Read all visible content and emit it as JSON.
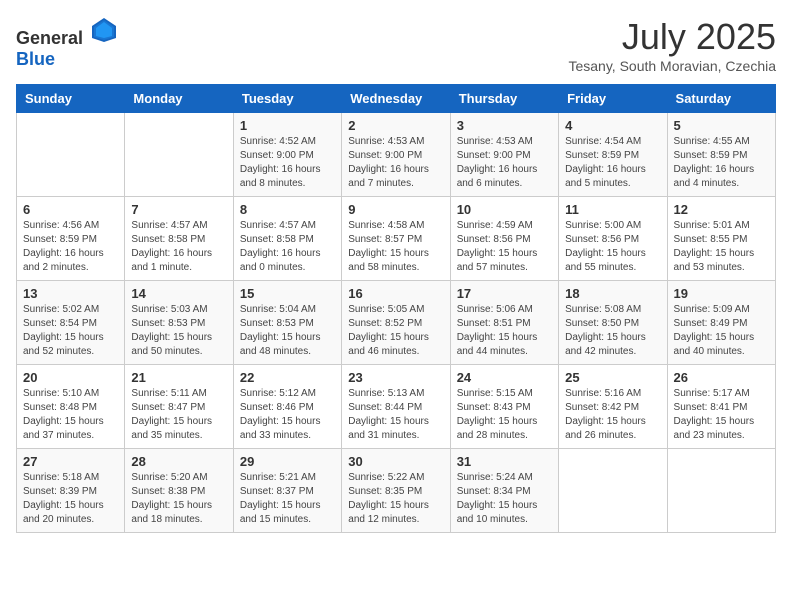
{
  "header": {
    "logo_general": "General",
    "logo_blue": "Blue",
    "month": "July 2025",
    "location": "Tesany, South Moravian, Czechia"
  },
  "days_of_week": [
    "Sunday",
    "Monday",
    "Tuesday",
    "Wednesday",
    "Thursday",
    "Friday",
    "Saturday"
  ],
  "weeks": [
    [
      {
        "day": "",
        "info": ""
      },
      {
        "day": "",
        "info": ""
      },
      {
        "day": "1",
        "info": "Sunrise: 4:52 AM\nSunset: 9:00 PM\nDaylight: 16 hours and 8 minutes."
      },
      {
        "day": "2",
        "info": "Sunrise: 4:53 AM\nSunset: 9:00 PM\nDaylight: 16 hours and 7 minutes."
      },
      {
        "day": "3",
        "info": "Sunrise: 4:53 AM\nSunset: 9:00 PM\nDaylight: 16 hours and 6 minutes."
      },
      {
        "day": "4",
        "info": "Sunrise: 4:54 AM\nSunset: 8:59 PM\nDaylight: 16 hours and 5 minutes."
      },
      {
        "day": "5",
        "info": "Sunrise: 4:55 AM\nSunset: 8:59 PM\nDaylight: 16 hours and 4 minutes."
      }
    ],
    [
      {
        "day": "6",
        "info": "Sunrise: 4:56 AM\nSunset: 8:59 PM\nDaylight: 16 hours and 2 minutes."
      },
      {
        "day": "7",
        "info": "Sunrise: 4:57 AM\nSunset: 8:58 PM\nDaylight: 16 hours and 1 minute."
      },
      {
        "day": "8",
        "info": "Sunrise: 4:57 AM\nSunset: 8:58 PM\nDaylight: 16 hours and 0 minutes."
      },
      {
        "day": "9",
        "info": "Sunrise: 4:58 AM\nSunset: 8:57 PM\nDaylight: 15 hours and 58 minutes."
      },
      {
        "day": "10",
        "info": "Sunrise: 4:59 AM\nSunset: 8:56 PM\nDaylight: 15 hours and 57 minutes."
      },
      {
        "day": "11",
        "info": "Sunrise: 5:00 AM\nSunset: 8:56 PM\nDaylight: 15 hours and 55 minutes."
      },
      {
        "day": "12",
        "info": "Sunrise: 5:01 AM\nSunset: 8:55 PM\nDaylight: 15 hours and 53 minutes."
      }
    ],
    [
      {
        "day": "13",
        "info": "Sunrise: 5:02 AM\nSunset: 8:54 PM\nDaylight: 15 hours and 52 minutes."
      },
      {
        "day": "14",
        "info": "Sunrise: 5:03 AM\nSunset: 8:53 PM\nDaylight: 15 hours and 50 minutes."
      },
      {
        "day": "15",
        "info": "Sunrise: 5:04 AM\nSunset: 8:53 PM\nDaylight: 15 hours and 48 minutes."
      },
      {
        "day": "16",
        "info": "Sunrise: 5:05 AM\nSunset: 8:52 PM\nDaylight: 15 hours and 46 minutes."
      },
      {
        "day": "17",
        "info": "Sunrise: 5:06 AM\nSunset: 8:51 PM\nDaylight: 15 hours and 44 minutes."
      },
      {
        "day": "18",
        "info": "Sunrise: 5:08 AM\nSunset: 8:50 PM\nDaylight: 15 hours and 42 minutes."
      },
      {
        "day": "19",
        "info": "Sunrise: 5:09 AM\nSunset: 8:49 PM\nDaylight: 15 hours and 40 minutes."
      }
    ],
    [
      {
        "day": "20",
        "info": "Sunrise: 5:10 AM\nSunset: 8:48 PM\nDaylight: 15 hours and 37 minutes."
      },
      {
        "day": "21",
        "info": "Sunrise: 5:11 AM\nSunset: 8:47 PM\nDaylight: 15 hours and 35 minutes."
      },
      {
        "day": "22",
        "info": "Sunrise: 5:12 AM\nSunset: 8:46 PM\nDaylight: 15 hours and 33 minutes."
      },
      {
        "day": "23",
        "info": "Sunrise: 5:13 AM\nSunset: 8:44 PM\nDaylight: 15 hours and 31 minutes."
      },
      {
        "day": "24",
        "info": "Sunrise: 5:15 AM\nSunset: 8:43 PM\nDaylight: 15 hours and 28 minutes."
      },
      {
        "day": "25",
        "info": "Sunrise: 5:16 AM\nSunset: 8:42 PM\nDaylight: 15 hours and 26 minutes."
      },
      {
        "day": "26",
        "info": "Sunrise: 5:17 AM\nSunset: 8:41 PM\nDaylight: 15 hours and 23 minutes."
      }
    ],
    [
      {
        "day": "27",
        "info": "Sunrise: 5:18 AM\nSunset: 8:39 PM\nDaylight: 15 hours and 20 minutes."
      },
      {
        "day": "28",
        "info": "Sunrise: 5:20 AM\nSunset: 8:38 PM\nDaylight: 15 hours and 18 minutes."
      },
      {
        "day": "29",
        "info": "Sunrise: 5:21 AM\nSunset: 8:37 PM\nDaylight: 15 hours and 15 minutes."
      },
      {
        "day": "30",
        "info": "Sunrise: 5:22 AM\nSunset: 8:35 PM\nDaylight: 15 hours and 12 minutes."
      },
      {
        "day": "31",
        "info": "Sunrise: 5:24 AM\nSunset: 8:34 PM\nDaylight: 15 hours and 10 minutes."
      },
      {
        "day": "",
        "info": ""
      },
      {
        "day": "",
        "info": ""
      }
    ]
  ]
}
